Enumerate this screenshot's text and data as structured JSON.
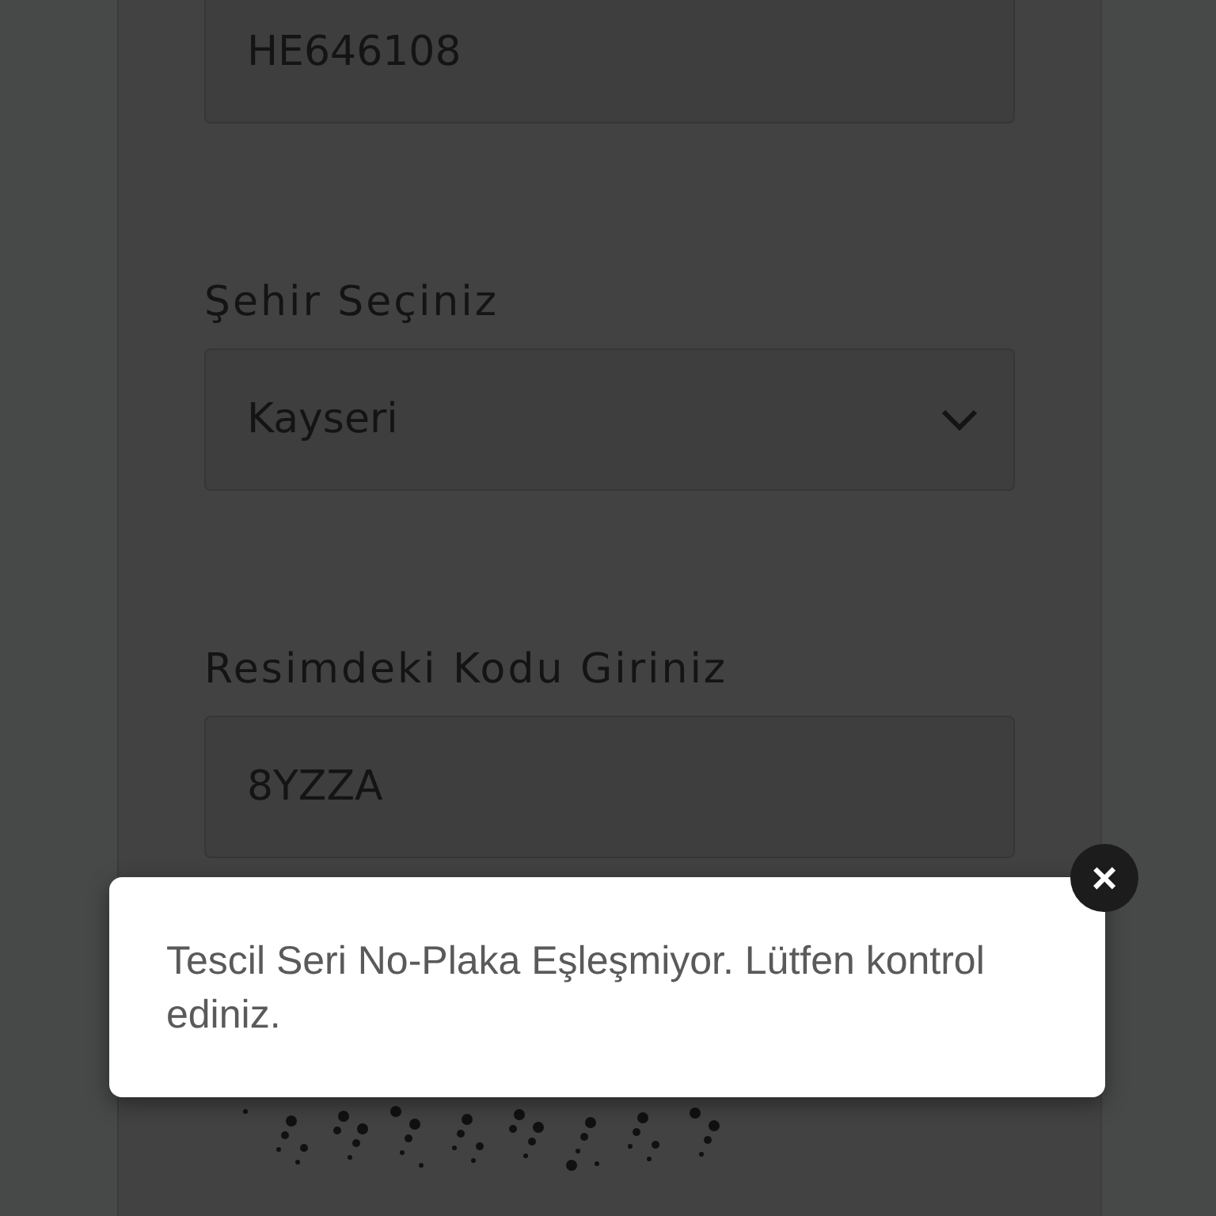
{
  "fields": [
    {
      "kind": "input",
      "value": "HE646108"
    },
    {
      "kind": "select",
      "label": "Şehir Seçiniz",
      "value": "Kayseri"
    },
    {
      "kind": "input",
      "label": "Resimdeki Kodu Giriniz",
      "value": "8YZZA"
    }
  ],
  "alert": {
    "message": "Tescil Seri No-Plaka Eşleşmiyor. Lütfen kontrol ediniz.",
    "close": "×"
  }
}
